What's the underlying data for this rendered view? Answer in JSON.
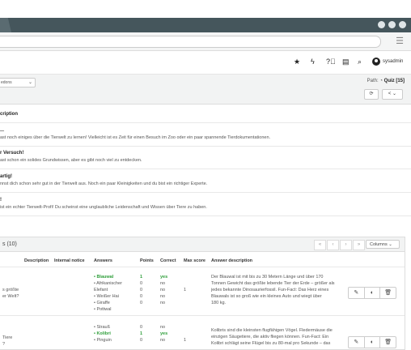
{
  "header": {
    "icons": [
      "star-icon",
      "bolt-icon",
      "help-icon",
      "notes-icon",
      "search-icon"
    ],
    "username": "sysadmin"
  },
  "toolbar": {
    "select_value": "edons",
    "path_label": "Path:",
    "path_current": "Quiz [15]"
  },
  "feedback": {
    "heading": "cription",
    "items": [
      {
        "title": "...",
        "text": "ast noch einiges über die Tierwelt zu lernen! Vielleicht ist es Zeit für einen Besuch im Zoo oder ein paar spannende Tierdokumentationen."
      },
      {
        "title": "r Versuch!",
        "text": "ast schon ein solides Grundwissen, aber es gibt noch viel zu entdecken."
      },
      {
        "title": "artig!",
        "text": "nnst dich schon sehr gut in der Tierwelt aus. Noch ein paar Kleinigkeiten und du bist ein richtiger Experte."
      },
      {
        "title": "!",
        "text": "ist ein echter Tierwelt-Profi! Du scheinst eine unglaubliche Leidenschaft und Wissen über Tiere zu haben."
      }
    ]
  },
  "questions": {
    "title": "s (10)",
    "pager": [
      "«",
      "‹",
      "›",
      "»"
    ],
    "columns_label": "Columns",
    "headers": [
      "Description",
      "Internal notice",
      "Answers",
      "Points",
      "Correct",
      "Max score",
      "Answer description"
    ],
    "rows": [
      {
        "question": [
          "s größte",
          "er Welt?"
        ],
        "answers": [
          "• Blauwal",
          "• Afrikanischer",
          "Elefant",
          "• Weißer Hai",
          "• Giraffe",
          "• Pottwal"
        ],
        "points": [
          "1",
          "0",
          "",
          "0",
          "0",
          "0"
        ],
        "correct": [
          "yes",
          "no",
          "",
          "no",
          "no",
          "no"
        ],
        "max_score": "1",
        "description": [
          "Der Blauwal ist mit bis zu 30 Metern Länge und über 170",
          "Tonnen Gewicht das größte lebende Tier der Erde – größer als",
          "jedes bekannte Dinosaurierfossil. Fun-Fact: Das Herz eines",
          "Blauwals ist so groß wie ein kleines Auto und wiegt über",
          "180 kg."
        ]
      },
      {
        "question": [
          "Tiere",
          "?"
        ],
        "answers": [
          "• Strauß",
          "• Kolibri",
          "• Pinguin"
        ],
        "points": [
          "0",
          "1",
          "0"
        ],
        "correct": [
          "no",
          "yes",
          "no"
        ],
        "max_score": "1",
        "description": [
          "Kolibris sind die kleinsten flugfähigen Vögel. Fledermäuse die",
          "einzigen Säugetiere, die aktiv fliegen können. Fun-Fact: Ein",
          "Kolibri schlägt seine Flügel bis zu 80-mal pro Sekunde – das"
        ]
      }
    ]
  }
}
